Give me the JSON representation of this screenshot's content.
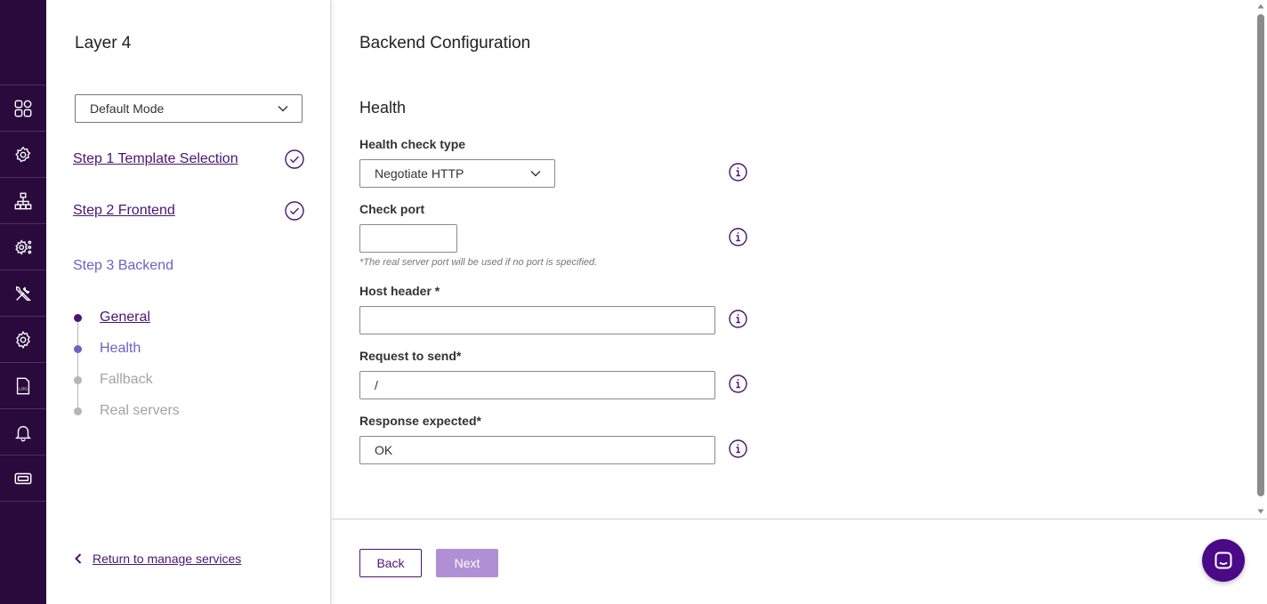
{
  "rail": {
    "icons": [
      "dashboard-icon",
      "virtual-services-icon",
      "network-icon",
      "system-config-icon",
      "tools-icon",
      "settings-icon",
      "logs-icon",
      "notifications-icon",
      "license-icon"
    ],
    "log_icon_text": "LOG"
  },
  "wizard": {
    "title": "Layer 4",
    "mode_select": {
      "value": "Default Mode"
    },
    "steps": [
      {
        "label": "Step 1 Template Selection",
        "completed": true
      },
      {
        "label": "Step 2 Frontend",
        "completed": true
      },
      {
        "label": "Step 3 Backend",
        "completed": false
      }
    ],
    "substeps": [
      {
        "label": "General",
        "state": "done",
        "color": "#4a1570"
      },
      {
        "label": "Health",
        "state": "current",
        "color": "#6b63c4"
      },
      {
        "label": "Fallback",
        "state": "pending",
        "color": "#a3a3a3"
      },
      {
        "label": "Real servers",
        "state": "pending",
        "color": "#a3a3a3"
      }
    ],
    "return_label": "Return to manage services"
  },
  "main": {
    "title": "Backend Configuration",
    "section": "Health",
    "fields": {
      "health_check_type": {
        "label": "Health check type",
        "value": "Negotiate HTTP"
      },
      "check_port": {
        "label": "Check port",
        "value": "",
        "hint": "*The real server port will be used if no port is specified."
      },
      "host_header": {
        "label": "Host header *",
        "value": ""
      },
      "request_to_send": {
        "label": "Request to send*",
        "value": "/"
      },
      "response_expected": {
        "label": "Response expected*",
        "value": "OK"
      }
    }
  },
  "footer": {
    "back_label": "Back",
    "next_label": "Next"
  },
  "colors": {
    "brand": "#2a0a3d",
    "accent": "#4a1570",
    "current": "#6b63c4",
    "next_disabled": "#b18fd4"
  }
}
